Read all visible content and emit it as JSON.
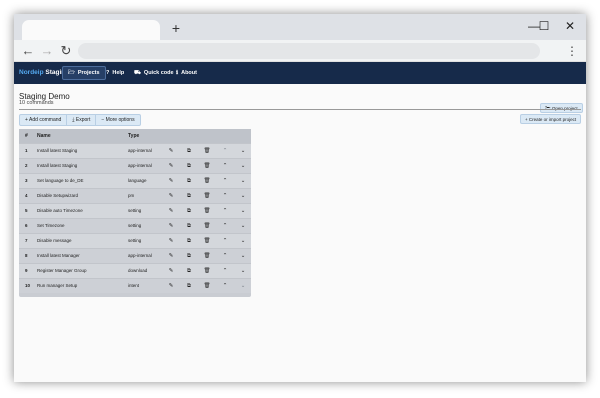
{
  "window": {
    "controls": {
      "minimize": "—",
      "maximize": "☐",
      "close": "✕"
    },
    "new_tab_glyph": "+"
  },
  "toolbar": {
    "back": "←",
    "forward": "→",
    "reload": "↻",
    "menu": "⋮"
  },
  "nav": {
    "brand_a": "Nordeip",
    "brand_b": "Staging",
    "items": [
      {
        "label": "Projects",
        "icon": "folder-icon",
        "glyph": "🗁",
        "active": true
      },
      {
        "label": "Help",
        "icon": "help-icon",
        "glyph": "?",
        "active": false
      },
      {
        "label": "Quick code",
        "icon": "car-icon",
        "glyph": "⛟",
        "active": false
      },
      {
        "label": "About",
        "icon": "info-icon",
        "glyph": "ℹ",
        "active": false
      }
    ],
    "colors": {
      "background": "#162a4a",
      "brand_accent": "#54a9f0"
    }
  },
  "page": {
    "title": "Staging Demo",
    "subtitle": "10 commands",
    "open_project": "Open project",
    "create_import": "Create or import project"
  },
  "actions": {
    "add": "Add command",
    "export": "Export",
    "more": "More options"
  },
  "table": {
    "headers": {
      "num": "#",
      "name": "Name",
      "type": "Type"
    },
    "rows": [
      {
        "num": "1",
        "name": "Install latest Staging",
        "type": "app-internal"
      },
      {
        "num": "2",
        "name": "Install latest Staging",
        "type": "app-internal"
      },
      {
        "num": "3",
        "name": "Set language to de_DE",
        "type": "language"
      },
      {
        "num": "4",
        "name": "Disable Setupwizard",
        "type": "pm"
      },
      {
        "num": "5",
        "name": "Disable auto Timezone",
        "type": "setting"
      },
      {
        "num": "6",
        "name": "Set Timezone",
        "type": "setting"
      },
      {
        "num": "7",
        "name": "Disable message",
        "type": "setting"
      },
      {
        "num": "8",
        "name": "Install latest Manager",
        "type": "app-internal"
      },
      {
        "num": "9",
        "name": "Register Manager Group",
        "type": "download"
      },
      {
        "num": "10",
        "name": "Run manager Setup",
        "type": "intent"
      }
    ]
  }
}
